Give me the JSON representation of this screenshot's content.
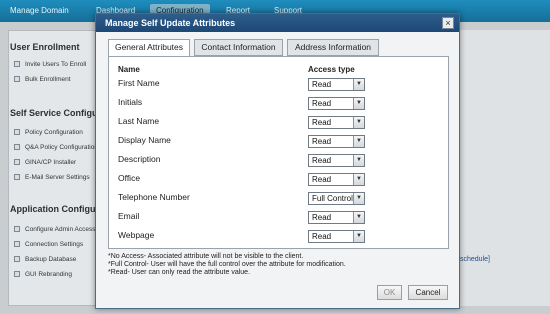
{
  "background": {
    "nav_tabs": [
      "Manage Domain",
      "Dashboard",
      "Configuration",
      "Report",
      "Support"
    ],
    "sections": [
      {
        "title": "User Enrollment",
        "items": [
          "Invite Users To Enroll",
          "Bulk Enrollment"
        ]
      },
      {
        "title": "Self Service Configuration",
        "items": [
          "Policy Configuration",
          "Q&A Policy Configuration",
          "GINA/CP Installer",
          "E-Mail Server Settings"
        ]
      },
      {
        "title": "Application Configuration",
        "items": [
          "Configure Admin Access",
          "Connection Settings",
          "Backup Database",
          "GUI Rebranding"
        ]
      }
    ],
    "right_link": "schedule]"
  },
  "dialog": {
    "title": "Manage Self Update Attributes",
    "close_label": "×",
    "tabs": [
      "General Attributes",
      "Contact Information",
      "Address Information"
    ],
    "active_tab": "General Attributes",
    "columns": {
      "name": "Name",
      "access": "Access type"
    },
    "rows": [
      {
        "name": "First Name",
        "access": "Read"
      },
      {
        "name": "Initials",
        "access": "Read"
      },
      {
        "name": "Last Name",
        "access": "Read"
      },
      {
        "name": "Display Name",
        "access": "Read"
      },
      {
        "name": "Description",
        "access": "Read"
      },
      {
        "name": "Office",
        "access": "Read"
      },
      {
        "name": "Telephone Number",
        "access": "Full Control"
      },
      {
        "name": "Email",
        "access": "Read"
      },
      {
        "name": "Webpage",
        "access": "Read"
      }
    ],
    "notes": [
      "*No Access- Associated attribute will not be visible to the client.",
      "*Full Control- User will have the full control over the attribute for modification.",
      "*Read- User can only read the attribute value."
    ],
    "ok_label": "OK",
    "cancel_label": "Cancel"
  }
}
